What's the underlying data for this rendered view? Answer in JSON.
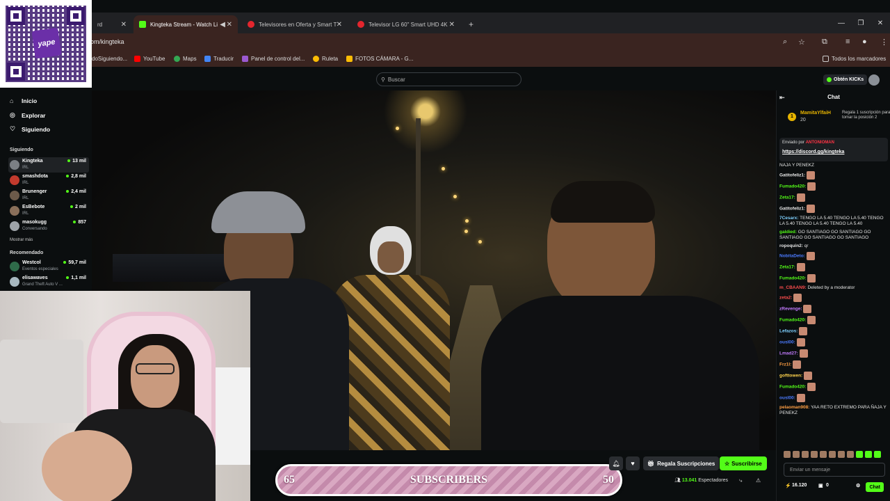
{
  "browser": {
    "tabs": [
      {
        "label": "rd"
      },
      {
        "label": "Kingteka Stream - Watch Li"
      },
      {
        "label": "Televisores en Oferta y Smart T"
      },
      {
        "label": "Televisor LG 60\" Smart UHD 4K"
      }
    ],
    "new_tab": "+",
    "url": "om/kingteka",
    "bookmarks": [
      "doSiguiendo...",
      "YouTube",
      "Maps",
      "Traducir",
      "Panel de control del...",
      "Ruleta",
      "FOTOS CÁMARA - G..."
    ],
    "all_bookmarks": "Todos los marcadores"
  },
  "overlay": {
    "qr_brand": "yape"
  },
  "kick": {
    "search_placeholder": "Buscar",
    "get_kicks": "Obtén KICKs"
  },
  "sidebar": {
    "nav": [
      {
        "label": "Inicio",
        "icon": "home-icon"
      },
      {
        "label": "Explorar",
        "icon": "compass-icon"
      },
      {
        "label": "Siguiendo",
        "icon": "heart-icon"
      }
    ],
    "following_title": "Siguiendo",
    "following": [
      {
        "name": "Kingteka",
        "category": "IRL",
        "viewers": "13 mil"
      },
      {
        "name": "smashdota",
        "category": "IRL",
        "viewers": "2,8 mil"
      },
      {
        "name": "Brunenger",
        "category": "IRL",
        "viewers": "2,4 mil"
      },
      {
        "name": "EsBebote",
        "category": "IRL",
        "viewers": "2 mil"
      },
      {
        "name": "masokugg",
        "category": "Conversando",
        "viewers": "857"
      }
    ],
    "show_more": "Mostrar más",
    "recommended_title": "Recomendado",
    "recommended": [
      {
        "name": "Westcol",
        "category": "Eventos especiales",
        "viewers": "59,7 mil"
      },
      {
        "name": "elisawaves",
        "category": "Grand Theft Auto V ...",
        "viewers": "1,1 mil"
      }
    ]
  },
  "subs_goal": {
    "current": "65",
    "label": "SUBSCRIBERS",
    "goal": "50"
  },
  "stream_actions": {
    "gift_subs": "Regala Suscripciones",
    "subscribe": "Suscribirse",
    "viewers_count": "13.041",
    "viewers_label": "Espectadores"
  },
  "chat": {
    "title": "Chat",
    "top_gifter": {
      "name": "MamitaYlfaiH",
      "count": "20",
      "cta": "Regala 1 suscripción para tomar la posición 2"
    },
    "pinned": {
      "by_label": "Enviado por",
      "by_user": "ANTONIOMAN",
      "link": "https://discord.gg/kingteka"
    },
    "messages": [
      {
        "user": "",
        "text": "ÑAJA Y PENEKZ",
        "color": "#e6e6e6",
        "emote": false
      },
      {
        "user": "Gatitofeliz1:",
        "text": "",
        "color": "#e6e6e6",
        "emote": true
      },
      {
        "user": "Fumado420:",
        "text": "",
        "color": "#53fc18",
        "emote": true
      },
      {
        "user": "Zeta17:",
        "text": "",
        "color": "#53fc18",
        "emote": true
      },
      {
        "user": "Gatitofeliz1:",
        "text": "",
        "color": "#e6e6e6",
        "emote": true
      },
      {
        "user": "7Cesarx:",
        "text": "TENGO LA 5.40 TENGO LA 5.40 TENGO LA 5.40 TENGO LA 5.40 TENGO LA 5.40",
        "color": "#7fd1ff",
        "emote": false
      },
      {
        "user": "galdied:",
        "text": "GO SANTIAGO GO SANTIAGO GO SANTIAGO GO SANTIAGO GO SANTIAGO",
        "color": "#53fc18",
        "emote": false
      },
      {
        "user": "ropoquin2:",
        "text": "qr",
        "color": "#e6e6e6",
        "emote": false
      },
      {
        "user": "NobitaDeto:",
        "text": "",
        "color": "#4b7bff",
        "emote": true
      },
      {
        "user": "Zeta17:",
        "text": "",
        "color": "#53fc18",
        "emote": true
      },
      {
        "user": "Fumado420:",
        "text": "",
        "color": "#53fc18",
        "emote": true
      },
      {
        "user": "m_CBAAN9:",
        "text": "Deleted by a moderator",
        "color": "#ff4d4d",
        "emote": false
      },
      {
        "user": "zeta2:",
        "text": "",
        "color": "#ff4d4d",
        "emote": true
      },
      {
        "user": "zRevenge:",
        "text": "",
        "color": "#c27bff",
        "emote": true
      },
      {
        "user": "Fumado420:",
        "text": "",
        "color": "#53fc18",
        "emote": true
      },
      {
        "user": "Lefazos:",
        "text": "",
        "color": "#7fd1ff",
        "emote": true
      },
      {
        "user": "ousl00:",
        "text": "",
        "color": "#4b7bff",
        "emote": true
      },
      {
        "user": "Lmad27:",
        "text": "",
        "color": "#c27bff",
        "emote": true
      },
      {
        "user": "Frz1l:",
        "text": "",
        "color": "#ff9f43",
        "emote": true
      },
      {
        "user": "gofttowen:",
        "text": "",
        "color": "#ffd34d",
        "emote": true
      },
      {
        "user": "Fumado420:",
        "text": "",
        "color": "#53fc18",
        "emote": true
      },
      {
        "user": "ousl00:",
        "text": "",
        "color": "#4b7bff",
        "emote": true
      },
      {
        "user": "pelaoman908:",
        "text": "YAA RETO EXTREMO PARA ÑAJA Y PENEKZ",
        "color": "#ff9f43",
        "emote": false
      }
    ],
    "input_placeholder": "Enviar un mensaje",
    "kicks_balance": "16.120",
    "gift_count": "0",
    "chat_button": "Chat"
  },
  "colors": {
    "kick_green": "#53fc18",
    "chrome_tab_active": "#3a2420"
  }
}
